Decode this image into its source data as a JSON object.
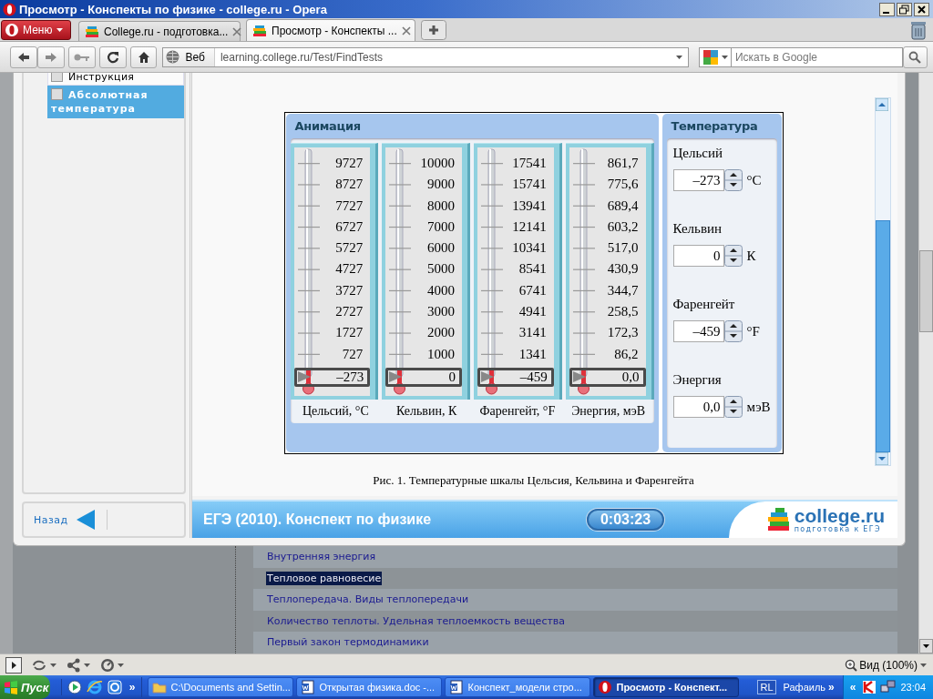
{
  "window": {
    "title": "Просмотр - Конспекты по физике - college.ru - Opera"
  },
  "menu_button": {
    "label": "Меню"
  },
  "tabs": [
    {
      "label": "College.ru - подготовка...",
      "selected": false
    },
    {
      "label": "Просмотр - Конспекты ...",
      "selected": true
    }
  ],
  "address_bar": {
    "scope": "Веб",
    "url": "learning.college.ru/Test/FindTests"
  },
  "search": {
    "placeholder": "Искать в Google"
  },
  "sidebar": {
    "items": [
      {
        "label": "Инструкция",
        "selected": false
      },
      {
        "label": "Абсолютная температура",
        "selected": true
      }
    ],
    "back_link": "Назад"
  },
  "animation": {
    "title": "Анимация",
    "thermometers": [
      {
        "ticks": [
          "9727",
          "8727",
          "7727",
          "6727",
          "5727",
          "4727",
          "3727",
          "2727",
          "1727",
          "727"
        ],
        "reading": "–273",
        "caption": "Цельсий, °C",
        "level": 0
      },
      {
        "ticks": [
          "10000",
          "9000",
          "8000",
          "7000",
          "6000",
          "5000",
          "4000",
          "3000",
          "2000",
          "1000"
        ],
        "reading": "0",
        "caption": "Кельвин, К",
        "level": 0
      },
      {
        "ticks": [
          "17541",
          "15741",
          "13941",
          "12141",
          "10341",
          "8541",
          "6741",
          "4941",
          "3141",
          "1341"
        ],
        "reading": "–459",
        "caption": "Фаренгейт, °F",
        "level": 0
      },
      {
        "ticks": [
          "861,7",
          "775,6",
          "689,4",
          "603,2",
          "517,0",
          "430,9",
          "344,7",
          "258,5",
          "172,3",
          "86,2"
        ],
        "reading": "0,0",
        "caption": "Энергия, мэВ",
        "level": 0
      }
    ]
  },
  "temperature": {
    "title": "Температура",
    "fields": [
      {
        "label": "Цельсий",
        "value": "–273",
        "unit": "°C"
      },
      {
        "label": "Кельвин",
        "value": "0",
        "unit": "К"
      },
      {
        "label": "Фаренгейт",
        "value": "–459",
        "unit": "°F"
      },
      {
        "label": "Энергия",
        "value": "0,0",
        "unit": "мэВ"
      }
    ]
  },
  "figure_caption": "Рис. 1. Температурные шкалы Цельсия, Кельвина и Фаренгейта",
  "footer": {
    "title": "ЕГЭ (2010). Конспект по физике",
    "timer": "0:03:23",
    "logo": "college.ru",
    "tagline": "подготовка к ЕГЭ"
  },
  "page_links": [
    {
      "label": "Внутренняя энергия",
      "selected": false
    },
    {
      "label": "Тепловое равновесие",
      "selected": true
    },
    {
      "label": "Теплопередача. Виды теплопередачи",
      "selected": false
    },
    {
      "label": "Количество теплоты. Удельная теплоемкость вещества",
      "selected": false
    },
    {
      "label": "Первый закон термодинамики",
      "selected": false
    }
  ],
  "status_bar": {
    "zoom": "Вид (100%)"
  },
  "taskbar": {
    "start": "Пуск",
    "quick_launch_more": "»",
    "tasks": [
      {
        "label": "C:\\Documents and Settin...",
        "kind": "folder",
        "selected": false
      },
      {
        "label": "Открытая физика.doc -...",
        "kind": "document",
        "selected": false
      },
      {
        "label": "Конспект_модели стро...",
        "kind": "document",
        "selected": false
      },
      {
        "label": "Просмотр - Конспект...",
        "kind": "browser",
        "selected": true
      }
    ],
    "language": "RL",
    "toolbar": "Рафаиль",
    "toolbar_more": "»",
    "tray_expand": "«",
    "clock": "23:04"
  }
}
